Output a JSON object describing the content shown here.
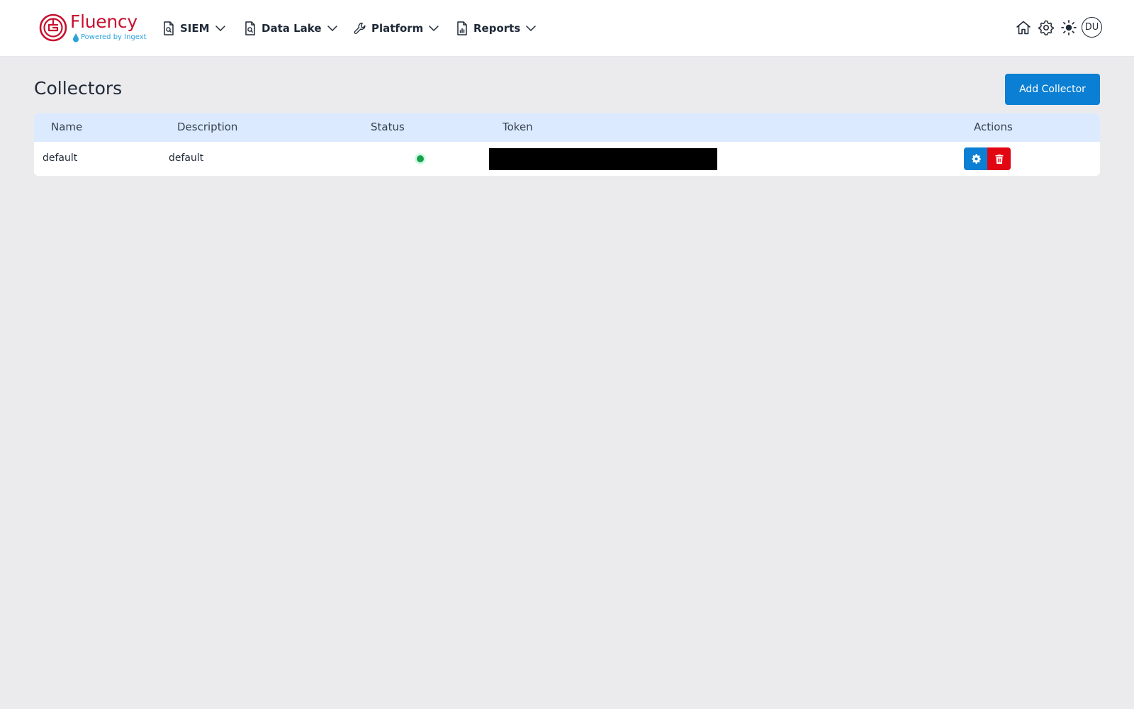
{
  "brand": {
    "name": "Fluency",
    "tagline": "Powered by Ingext",
    "primary_color": "#c8102e",
    "tagline_color": "#2aa3dd"
  },
  "nav": {
    "items": [
      {
        "label": "SIEM",
        "icon": "file-search-icon"
      },
      {
        "label": "Data Lake",
        "icon": "file-search-icon"
      },
      {
        "label": "Platform",
        "icon": "wrench-icon"
      },
      {
        "label": "Reports",
        "icon": "file-chart-icon"
      }
    ],
    "right_icons": [
      "home-icon",
      "gear-icon",
      "sun-icon"
    ],
    "user_initials": "DU"
  },
  "page": {
    "title": "Collectors",
    "add_button_label": "Add Collector"
  },
  "table": {
    "columns": [
      "Name",
      "Description",
      "Status",
      "Token",
      "Actions"
    ],
    "rows": [
      {
        "name": "default",
        "description": "default",
        "status": "active",
        "token": "",
        "actions": [
          "settings",
          "delete"
        ]
      }
    ],
    "header_bg": "#dbeafe",
    "status_color": "#16a34a",
    "edit_color": "#0a7fd3",
    "delete_color": "#e10612"
  }
}
